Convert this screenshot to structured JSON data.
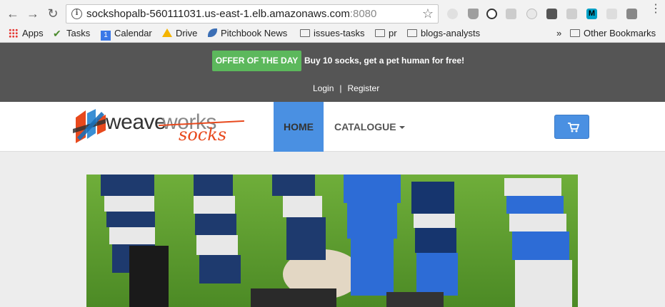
{
  "browser": {
    "url_host": "sockshopalb-560111031.us-east-1.elb.amazonaws.com",
    "url_port": ":8080",
    "nav": {
      "back_icon": "arrow-left-icon",
      "forward_icon": "arrow-right-icon",
      "reload_icon": "reload-icon"
    },
    "bookmarks": [
      {
        "label": "Apps",
        "icon": "apps-grid-icon"
      },
      {
        "label": "Tasks",
        "icon": "checkmark-icon"
      },
      {
        "label": "Calendar",
        "icon": "calendar-icon"
      },
      {
        "label": "Drive",
        "icon": "drive-icon"
      },
      {
        "label": "Pitchbook News",
        "icon": "feather-icon"
      },
      {
        "label": "issues-tasks",
        "icon": "folder-icon"
      },
      {
        "label": "pr",
        "icon": "folder-icon"
      },
      {
        "label": "blogs-analysts",
        "icon": "folder-icon"
      }
    ],
    "overflow_label": "»",
    "other_bookmarks": "Other Bookmarks"
  },
  "topbar": {
    "offer_label": "OFFER OF THE DAY",
    "offer_text": "Buy 10 socks, get a pet human for free!",
    "login": "Login",
    "separator": "|",
    "register": "Register"
  },
  "navbar": {
    "logo_weave": "weave",
    "logo_works": "works",
    "logo_socks": "socks",
    "home": "HOME",
    "catalogue": "CATALOGUE",
    "cart_icon": "shopping-cart-icon"
  },
  "colors": {
    "topbar_bg": "#555555",
    "offer_green": "#5cb85c",
    "accent_blue": "#4a90e2",
    "logo_orange": "#e8491d"
  }
}
